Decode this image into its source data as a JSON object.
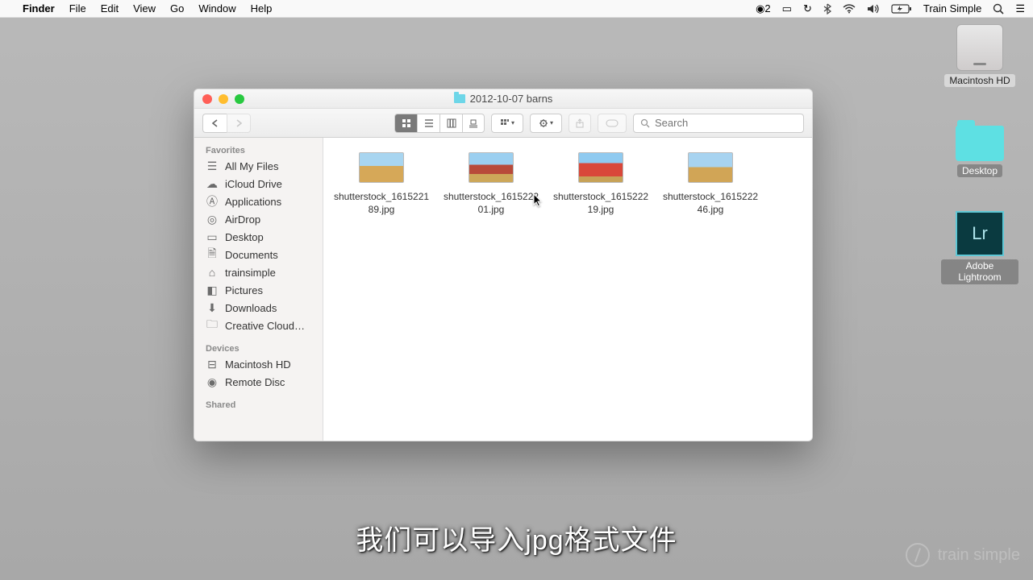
{
  "menubar": {
    "app_name": "Finder",
    "items": [
      "File",
      "Edit",
      "View",
      "Go",
      "Window",
      "Help"
    ],
    "status": {
      "icloud_count": "2",
      "user": "Train Simple"
    }
  },
  "desktop": {
    "hd_label": "Macintosh HD",
    "desktop_label": "Desktop",
    "lightroom_label": "Adobe Lightroom",
    "lr_glyph": "Lr"
  },
  "finder": {
    "title": "2012-10-07 barns",
    "search_placeholder": "Search",
    "sidebar": {
      "favorites_header": "Favorites",
      "devices_header": "Devices",
      "shared_header": "Shared",
      "favorites": [
        {
          "label": "All My Files"
        },
        {
          "label": "iCloud Drive"
        },
        {
          "label": "Applications"
        },
        {
          "label": "AirDrop"
        },
        {
          "label": "Desktop"
        },
        {
          "label": "Documents"
        },
        {
          "label": "trainsimple"
        },
        {
          "label": "Pictures"
        },
        {
          "label": "Downloads"
        },
        {
          "label": "Creative Cloud…"
        }
      ],
      "devices": [
        {
          "label": "Macintosh HD"
        },
        {
          "label": "Remote Disc"
        }
      ]
    },
    "files": [
      {
        "name": "shutterstock_161522189.jpg"
      },
      {
        "name": "shutterstock_161522201.jpg"
      },
      {
        "name": "shutterstock_161522219.jpg"
      },
      {
        "name": "shutterstock_161522246.jpg"
      }
    ]
  },
  "subtitle": "我们可以导入jpg格式文件",
  "watermark": {
    "right": "train simple"
  }
}
